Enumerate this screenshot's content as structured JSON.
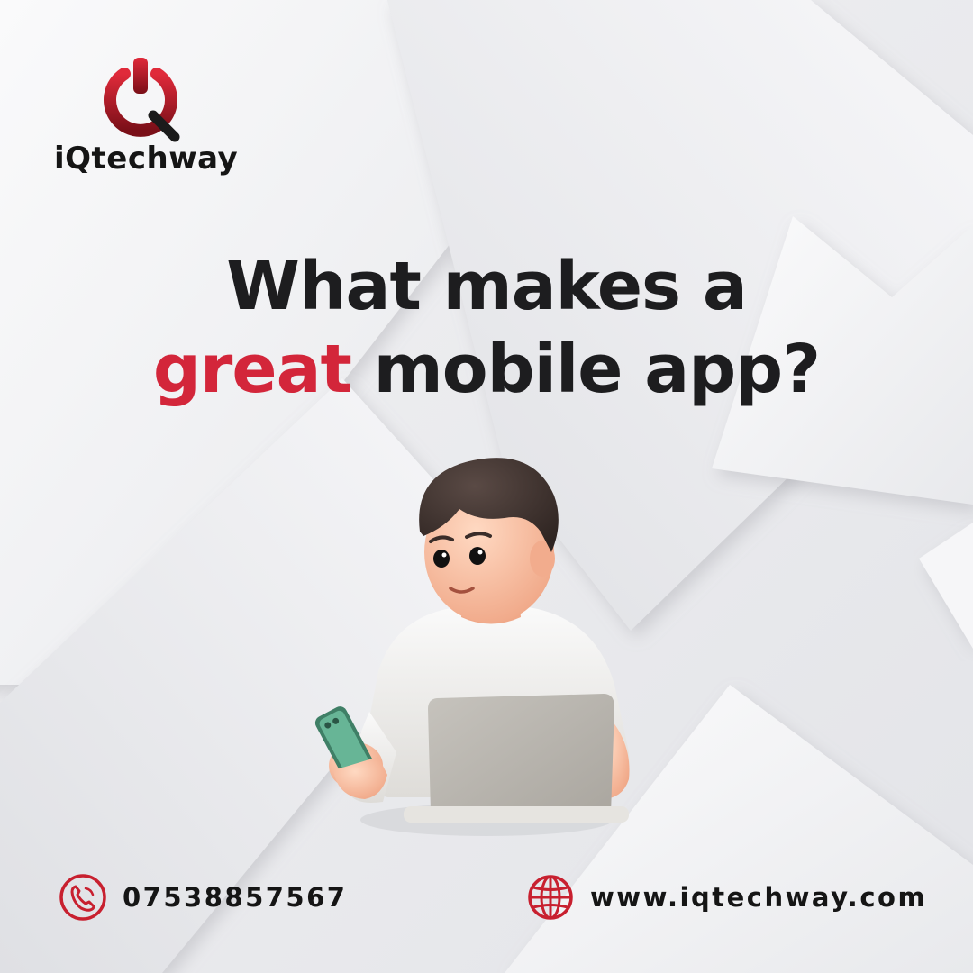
{
  "brand": {
    "name": "iQtechway",
    "accent_color": "#c8202f",
    "logo_icon": "power-q-logo"
  },
  "headline": {
    "line1": "What makes a",
    "highlight": "great",
    "line2_rest": "mobile app?"
  },
  "illustration": {
    "subject": "person-using-phone-and-laptop"
  },
  "contact": {
    "phone": "07538857567",
    "phone_icon": "phone-icon",
    "website": "www.iqtechway.com",
    "website_icon": "globe-icon"
  }
}
